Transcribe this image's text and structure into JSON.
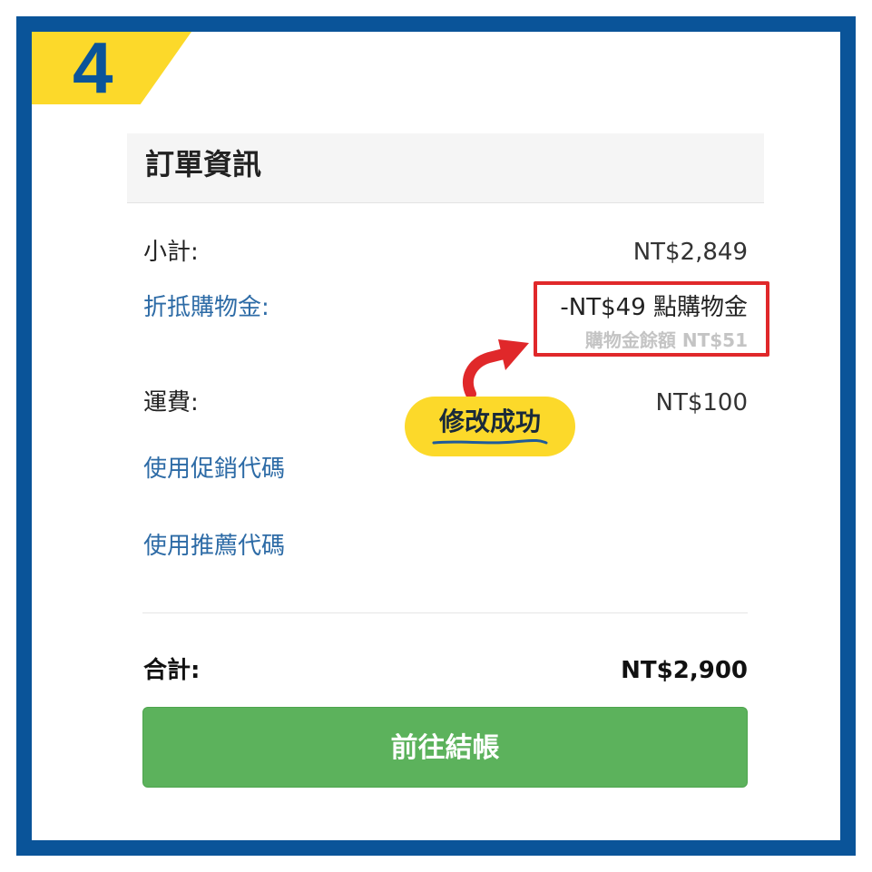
{
  "step": {
    "number": "4"
  },
  "panel": {
    "title": "訂單資訊"
  },
  "rows": {
    "subtotal": {
      "label": "小計:",
      "value": "NT$2,849"
    },
    "credit": {
      "label": "折抵購物金:",
      "value": "-NT$49 點購物金",
      "balance": "購物金餘額 NT$51"
    },
    "shipping": {
      "label": "運費:",
      "value": "NT$100"
    },
    "total": {
      "label": "合計:",
      "value": "NT$2,900"
    }
  },
  "links": {
    "promo": "使用促銷代碼",
    "referral": "使用推薦代碼"
  },
  "annotation": {
    "success_text": "修改成功"
  },
  "checkout": {
    "label": "前往結帳"
  },
  "colors": {
    "frame": "#0a5499",
    "badge": "#fcd92a",
    "link": "#2d6ba6",
    "highlight": "#e0282a",
    "button": "#5cb25c"
  },
  "icons": {
    "annotation_arrow": "curved-arrow-icon"
  }
}
